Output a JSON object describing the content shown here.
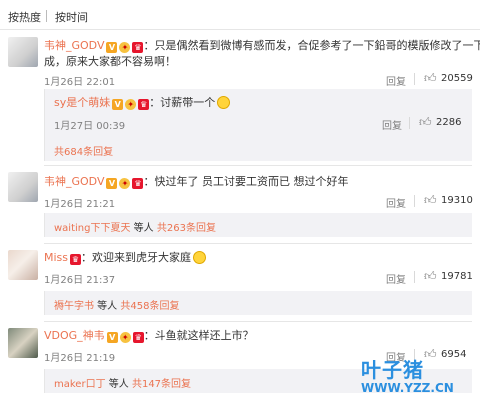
{
  "sort_tabs": [
    "按热度",
    "按时间"
  ],
  "comments": [
    {
      "nick": "韦神_GODV",
      "text_line1": "：只是偶然看到微博有感而发，合促参考了一下鉛哥的模版修改了一下。",
      "text_line2": "成，原来大家都不容易啊！",
      "time": "1月26日 22:01",
      "reply_label": "回复",
      "likes": "20559"
    },
    {
      "nick": "sy是个萌妹",
      "text": "：讨薪带一个",
      "time": "1月27日 00:39",
      "reply_label": "回复",
      "likes": "2286",
      "more": "共684条回复"
    },
    {
      "nick": "韦神_GODV",
      "text": "：快过年了 员工讨要工资而已 想过个好年",
      "time": "1月26日 21:21",
      "reply_label": "回复",
      "likes": "19310",
      "sub_nick": "waiting下下夏天",
      "sub_mid": " 等人",
      "sub_more": "共263条回复"
    },
    {
      "nick": "Miss",
      "text": "：欢迎来到虎牙大家庭",
      "time": "1月26日 21:37",
      "reply_label": "回复",
      "likes": "19781",
      "sub_nick": "褥午字书",
      "sub_mid": " 等人",
      "sub_more": "共458条回复"
    },
    {
      "nick": "VDOG_神韦",
      "text": "：斗鱼就这样还上市？",
      "time": "1月26日 21:19",
      "reply_label": "回复",
      "likes": "6954",
      "sub_nick": "maker口丁",
      "sub_mid": " 等人",
      "sub_more": "共147条回复"
    }
  ],
  "icons": {
    "verified_badge": "V",
    "vip_badge": "vip-icon",
    "like": "thumb-up-icon",
    "emoji": "smiley-emoji-icon"
  },
  "watermark": {
    "title": "叶子猪",
    "sub": "游戏网",
    "url": "WWW.YZZ.CN"
  },
  "colors": {
    "nick": "#eb7350",
    "meta": "#808080",
    "subbox": "#f2f2f5",
    "watermark": "#2b8fdf"
  }
}
